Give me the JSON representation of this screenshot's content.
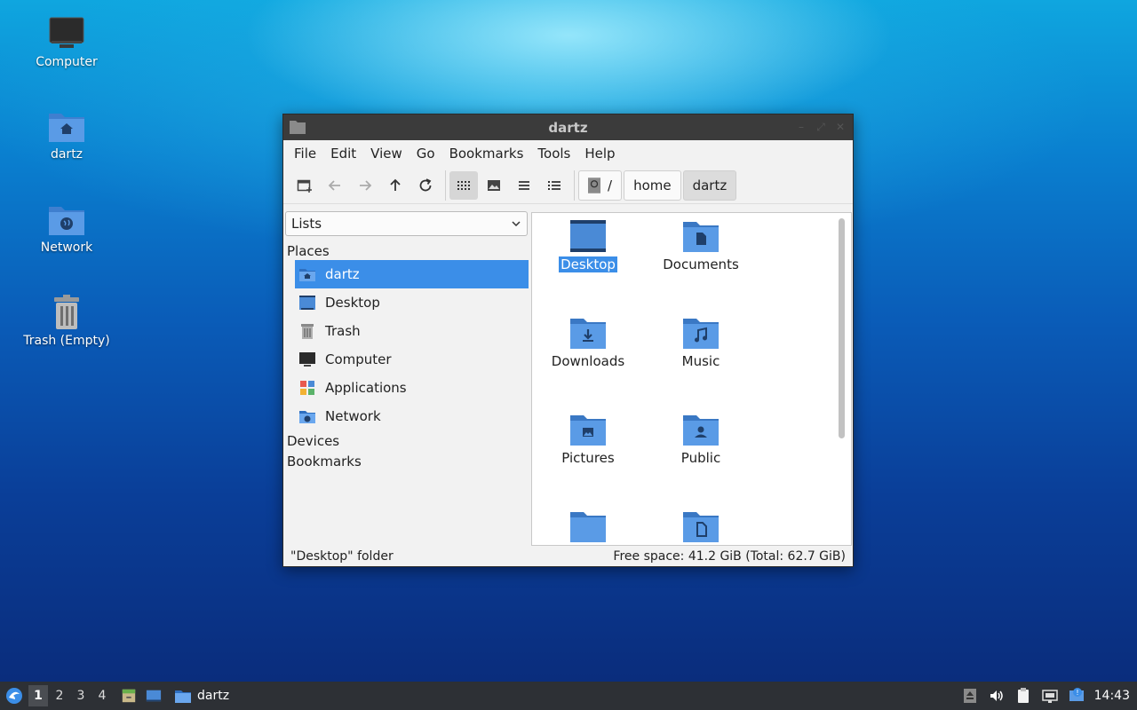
{
  "desktop": {
    "icons": [
      {
        "label": "Computer",
        "icon": "computer-icon"
      },
      {
        "label": "dartz",
        "icon": "home-folder-icon"
      },
      {
        "label": "Network",
        "icon": "network-folder-icon"
      },
      {
        "label": "Trash (Empty)",
        "icon": "trash-icon"
      }
    ]
  },
  "window": {
    "title": "dartz",
    "menu": [
      "File",
      "Edit",
      "View",
      "Go",
      "Bookmarks",
      "Tools",
      "Help"
    ],
    "path": {
      "root": "/",
      "segments": [
        "home",
        "dartz"
      ]
    },
    "sidebar": {
      "dropdown": "Lists",
      "places_heading": "Places",
      "places": [
        {
          "label": "dartz",
          "icon": "home-icon",
          "selected": true
        },
        {
          "label": "Desktop",
          "icon": "desktop-icon"
        },
        {
          "label": "Trash",
          "icon": "trash-icon"
        },
        {
          "label": "Computer",
          "icon": "computer-icon"
        },
        {
          "label": "Applications",
          "icon": "applications-icon"
        },
        {
          "label": "Network",
          "icon": "network-icon"
        }
      ],
      "devices_heading": "Devices",
      "bookmarks_heading": "Bookmarks"
    },
    "files": [
      {
        "label": "Desktop",
        "icon": "desktop-folder-icon",
        "selected": true
      },
      {
        "label": "Documents",
        "icon": "documents-folder-icon"
      },
      {
        "label": "Downloads",
        "icon": "downloads-folder-icon"
      },
      {
        "label": "Music",
        "icon": "music-folder-icon"
      },
      {
        "label": "Pictures",
        "icon": "pictures-folder-icon"
      },
      {
        "label": "Public",
        "icon": "public-folder-icon"
      },
      {
        "label": "",
        "icon": "folder-icon"
      },
      {
        "label": "",
        "icon": "templates-folder-icon"
      }
    ],
    "status": {
      "left": "\"Desktop\" folder",
      "right": "Free space: 41.2 GiB (Total: 62.7 GiB)"
    }
  },
  "taskbar": {
    "workspaces": [
      "1",
      "2",
      "3",
      "4"
    ],
    "active_workspace": "1",
    "task_label": "dartz",
    "clock": "14:43"
  },
  "colors": {
    "accent": "#3b8ee8",
    "folder": "#4a8ad6",
    "titlebar": "#3b3b3b",
    "taskbar": "#2d3035"
  }
}
